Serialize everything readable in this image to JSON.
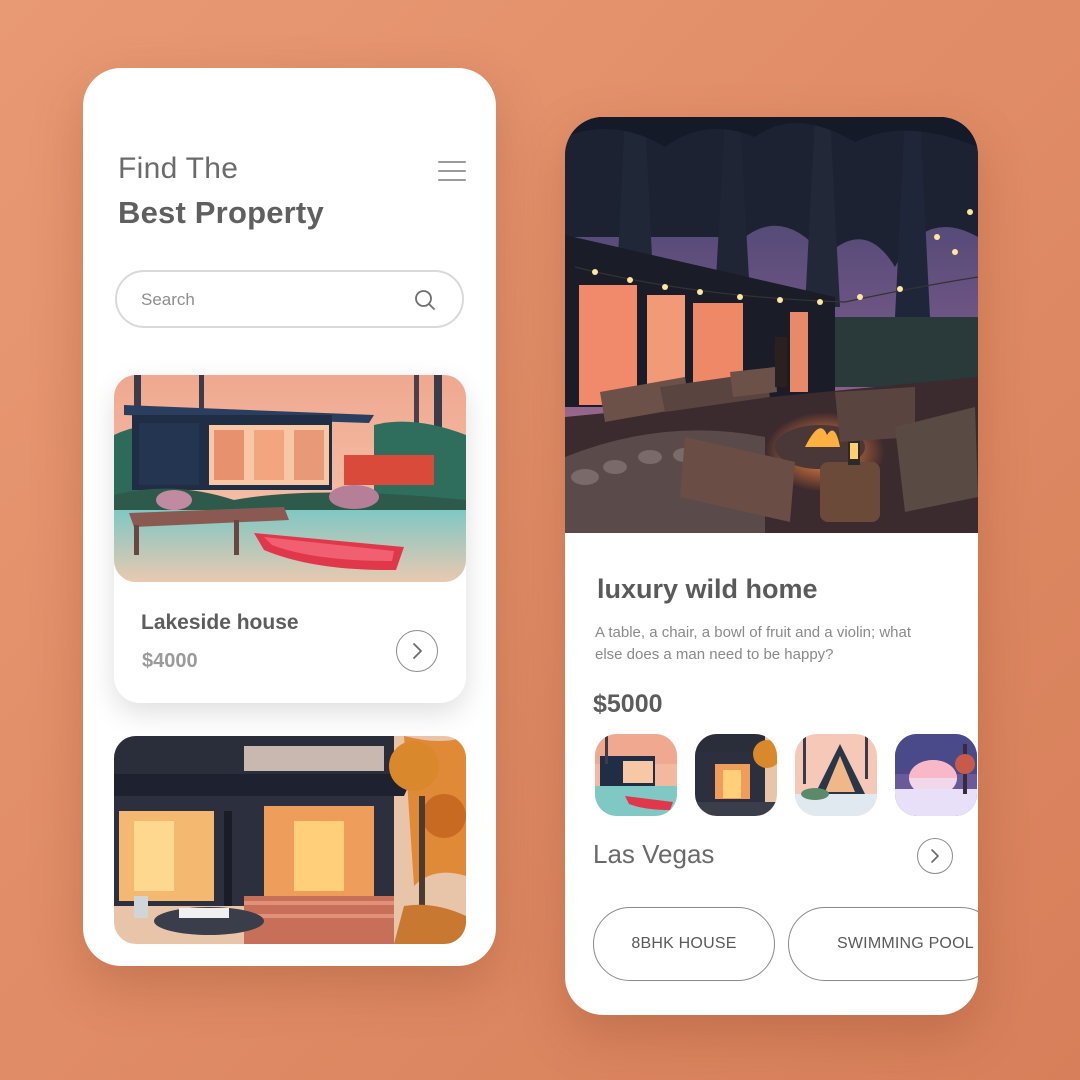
{
  "left_screen": {
    "title_line1": "Find The",
    "title_line2": "Best Property",
    "menu_icon": "hamburger-menu-icon",
    "search": {
      "placeholder": "Search",
      "icon": "search-icon"
    },
    "cards": [
      {
        "title": "Lakeside house",
        "price": "$4000",
        "image": "lakeside-house-illustration"
      },
      {
        "image": "modern-house-evening-illustration"
      }
    ]
  },
  "right_screen": {
    "hero_image": "forest-deck-campfire-illustration",
    "title": "luxury wild home",
    "description": "A table, a chair, a bowl of fruit and a violin; what else does a man need to be happy?",
    "price": "$5000",
    "thumbnails": [
      "lakeside-house",
      "modern-house",
      "a-frame-cabin",
      "winter-dome"
    ],
    "location": "Las Vegas",
    "tags": [
      "8BHK HOUSE",
      "SWIMMING POOL"
    ]
  },
  "colors": {
    "background": "#e3906b",
    "card": "#ffffff",
    "text_dark": "#5d5d5d",
    "text_muted": "#8a8a8a"
  }
}
